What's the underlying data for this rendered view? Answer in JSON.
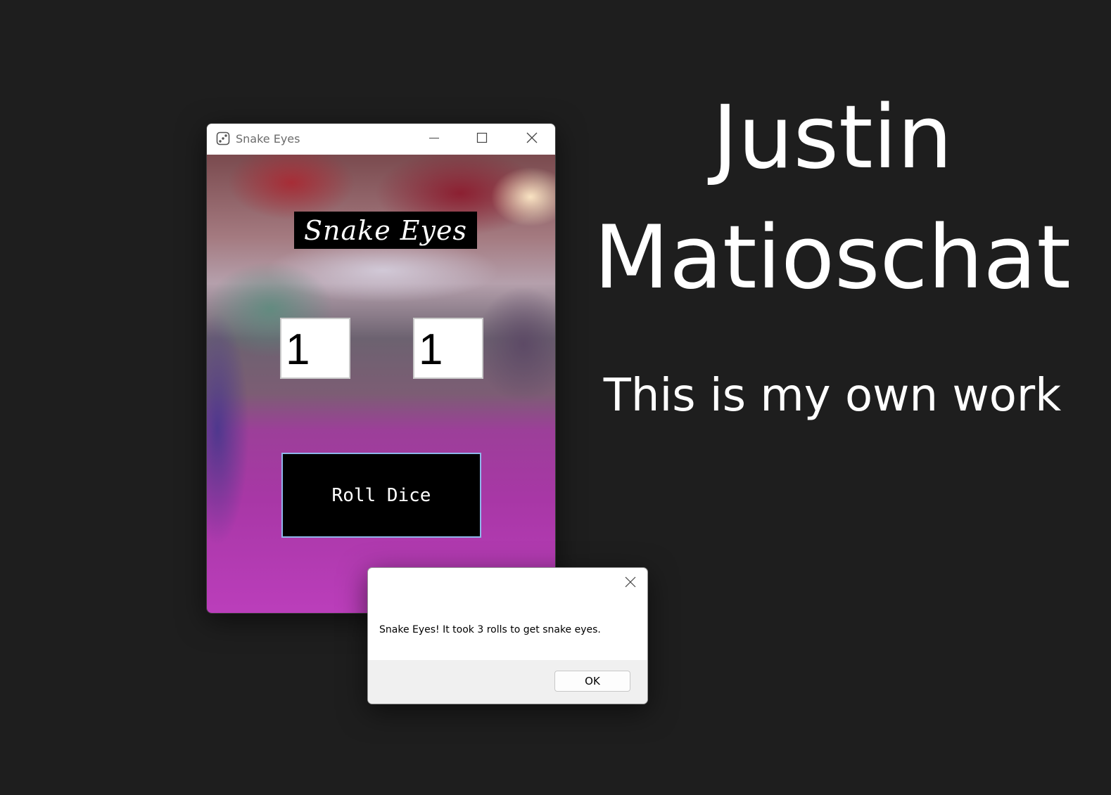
{
  "window": {
    "title": "Snake Eyes",
    "icon": "dice-icon"
  },
  "game": {
    "title": "Snake Eyes",
    "die1": "1",
    "die2": "1",
    "roll_button_label": "Roll Dice"
  },
  "dialog": {
    "message": "Snake Eyes! It took 3 rolls to get snake eyes.",
    "ok_label": "OK"
  },
  "credit": {
    "first_name": "Justin",
    "last_name": "Matioschat",
    "statement": "This is my own work"
  }
}
